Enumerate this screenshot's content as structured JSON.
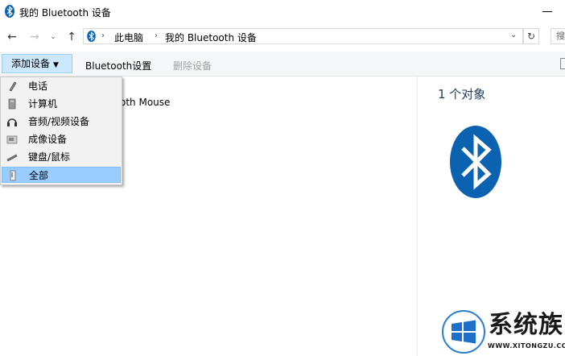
{
  "window": {
    "title": "我的 Bluetooth 设备"
  },
  "address": {
    "crumbs": [
      "此电脑",
      "我的 Bluetooth 设备"
    ]
  },
  "toolbar": {
    "add_device": "添加设备",
    "bluetooth_settings": "Bluetooth设置",
    "remove_device": "删除设备"
  },
  "content": {
    "device_partial_name": "oth Mouse"
  },
  "details": {
    "object_count": "1 个对象"
  },
  "menu": {
    "items": [
      {
        "label": "电话",
        "icon": "phone-icon"
      },
      {
        "label": "计算机",
        "icon": "computer-icon"
      },
      {
        "label": "音频/视频设备",
        "icon": "headphones-icon"
      },
      {
        "label": "成像设备",
        "icon": "imaging-device-icon"
      },
      {
        "label": "键盘/鼠标",
        "icon": "keyboard-icon"
      },
      {
        "label": "全部",
        "icon": "all-devices-icon",
        "selected": true
      }
    ]
  },
  "watermark": {
    "cn": "系统族",
    "en": "WWW.XITONGZU.COM"
  },
  "colors": {
    "bluetooth_blue": "#0a62b0",
    "toolbar_active": "#cce8ff",
    "menu_selected": "#99ccff",
    "details_text": "#1e3a5f"
  }
}
